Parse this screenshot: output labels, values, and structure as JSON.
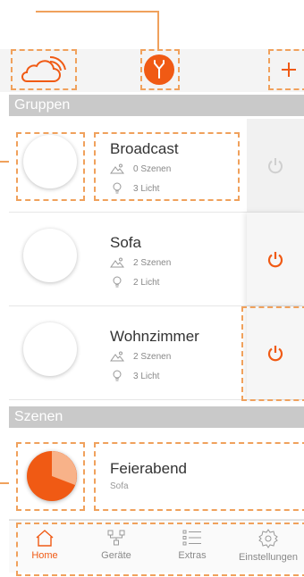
{
  "sections": {
    "groups": "Gruppen",
    "scenes": "Szenen"
  },
  "groups": [
    {
      "name": "Broadcast",
      "scenes": "0 Szenen",
      "lights": "3 Licht"
    },
    {
      "name": "Sofa",
      "scenes": "2 Szenen",
      "lights": "2 Licht"
    },
    {
      "name": "Wohnzimmer",
      "scenes": "2 Szenen",
      "lights": "3 Licht"
    }
  ],
  "scenes": [
    {
      "name": "Feierabend",
      "group": "Sofa"
    }
  ],
  "tabs": [
    {
      "label": "Home",
      "icon": "home-icon",
      "active": true
    },
    {
      "label": "Geräte",
      "icon": "devices-icon",
      "active": false
    },
    {
      "label": "Extras",
      "icon": "list-icon",
      "active": false
    },
    {
      "label": "Einstellungen",
      "icon": "gear-icon",
      "active": false
    }
  ],
  "colors": {
    "accent": "#f05a14",
    "annotation": "#f0a15c",
    "section_bg": "#c9c9c9"
  }
}
